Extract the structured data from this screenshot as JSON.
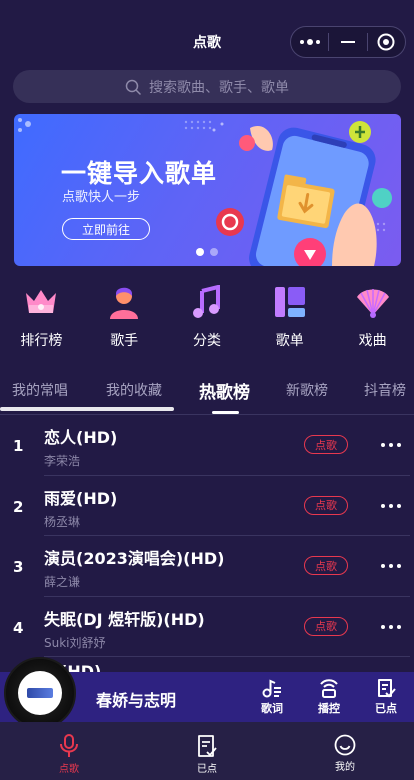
{
  "header": {
    "title": "点歌",
    "capsule": {
      "more_icon": "more-dots-icon",
      "minimize_icon": "minimize-icon",
      "close_icon": "target-close-icon"
    }
  },
  "search": {
    "placeholder": "搜索歌曲、歌手、歌单",
    "icon": "search-icon"
  },
  "banner": {
    "title": "一键导入歌单",
    "subtitle": "点歌快人一步",
    "button_label": "立即前往",
    "page_count": 2,
    "active_page": 1
  },
  "categories": [
    {
      "label": "排行榜",
      "icon": "crown-icon"
    },
    {
      "label": "歌手",
      "icon": "singer-icon"
    },
    {
      "label": "分类",
      "icon": "music-note-icon"
    },
    {
      "label": "歌单",
      "icon": "playlist-icon"
    },
    {
      "label": "戏曲",
      "icon": "fan-icon"
    }
  ],
  "tabs": [
    {
      "label": "我的常唱",
      "active": false
    },
    {
      "label": "我的收藏",
      "active": false
    },
    {
      "label": "热歌榜",
      "active": true
    },
    {
      "label": "新歌榜",
      "active": false
    },
    {
      "label": "抖音榜",
      "active": false
    }
  ],
  "songs": [
    {
      "rank": "1",
      "name": "恋人(HD)",
      "artist": "李荣浩",
      "action": "点歌"
    },
    {
      "rank": "2",
      "name": "雨爱(HD)",
      "artist": "杨丞琳",
      "action": "点歌"
    },
    {
      "rank": "3",
      "name": "演员(2023演唱会)(HD)",
      "artist": "薛之谦",
      "action": "点歌"
    },
    {
      "rank": "4",
      "name": "失眠(DJ 煜轩版)(HD)",
      "artist": "Suki刘舒妤",
      "action": "点歌"
    }
  ],
  "partial_song": {
    "name": "…(HD)"
  },
  "player": {
    "title": "春娇与志明",
    "buttons": [
      {
        "label": "歌词",
        "icon": "lyrics-icon"
      },
      {
        "label": "播控",
        "icon": "playback-control-icon"
      },
      {
        "label": "已点",
        "icon": "ordered-list-icon"
      }
    ]
  },
  "bottom_nav": [
    {
      "label": "点歌",
      "icon": "microphone-icon",
      "active": true
    },
    {
      "label": "已点",
      "icon": "checklist-icon",
      "active": false
    },
    {
      "label": "我的",
      "icon": "smiley-icon",
      "active": false
    }
  ],
  "colors": {
    "background": "#221a45",
    "accent_red": "#e8384f",
    "player_bar": "#2e2281",
    "banner_blue": "#3f6bff"
  }
}
